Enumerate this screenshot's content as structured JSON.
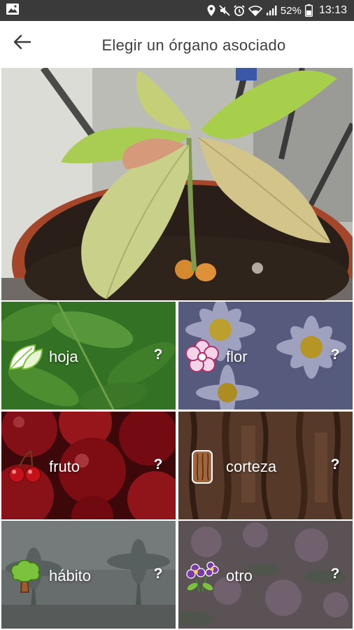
{
  "status_bar": {
    "battery_percent": "52%",
    "time": "13:13",
    "icons": [
      "gallery-icon",
      "location-icon",
      "mute-icon",
      "alarm-icon",
      "wifi-icon",
      "signal-icon",
      "battery-icon"
    ]
  },
  "app_bar": {
    "title": "Elegir un órgano asociado",
    "back_icon": "arrow-left-icon"
  },
  "hero": {
    "subject": "plant-photo"
  },
  "organs": [
    {
      "label": "hoja",
      "icon": "leaf-icon",
      "help": "?"
    },
    {
      "label": "flor",
      "icon": "flower-icon",
      "help": "?"
    },
    {
      "label": "fruto",
      "icon": "cherry-icon",
      "help": "?"
    },
    {
      "label": "corteza",
      "icon": "bark-icon",
      "help": "?"
    },
    {
      "label": "hábito",
      "icon": "tree-icon",
      "help": "?"
    },
    {
      "label": "otro",
      "icon": "other-flowers-icon",
      "help": "?"
    }
  ],
  "colors": {
    "status_bar": "#3a3a3a",
    "app_bar": "#ffffff",
    "title_text": "#3f3f3f",
    "tile_text": "#ffffff"
  }
}
